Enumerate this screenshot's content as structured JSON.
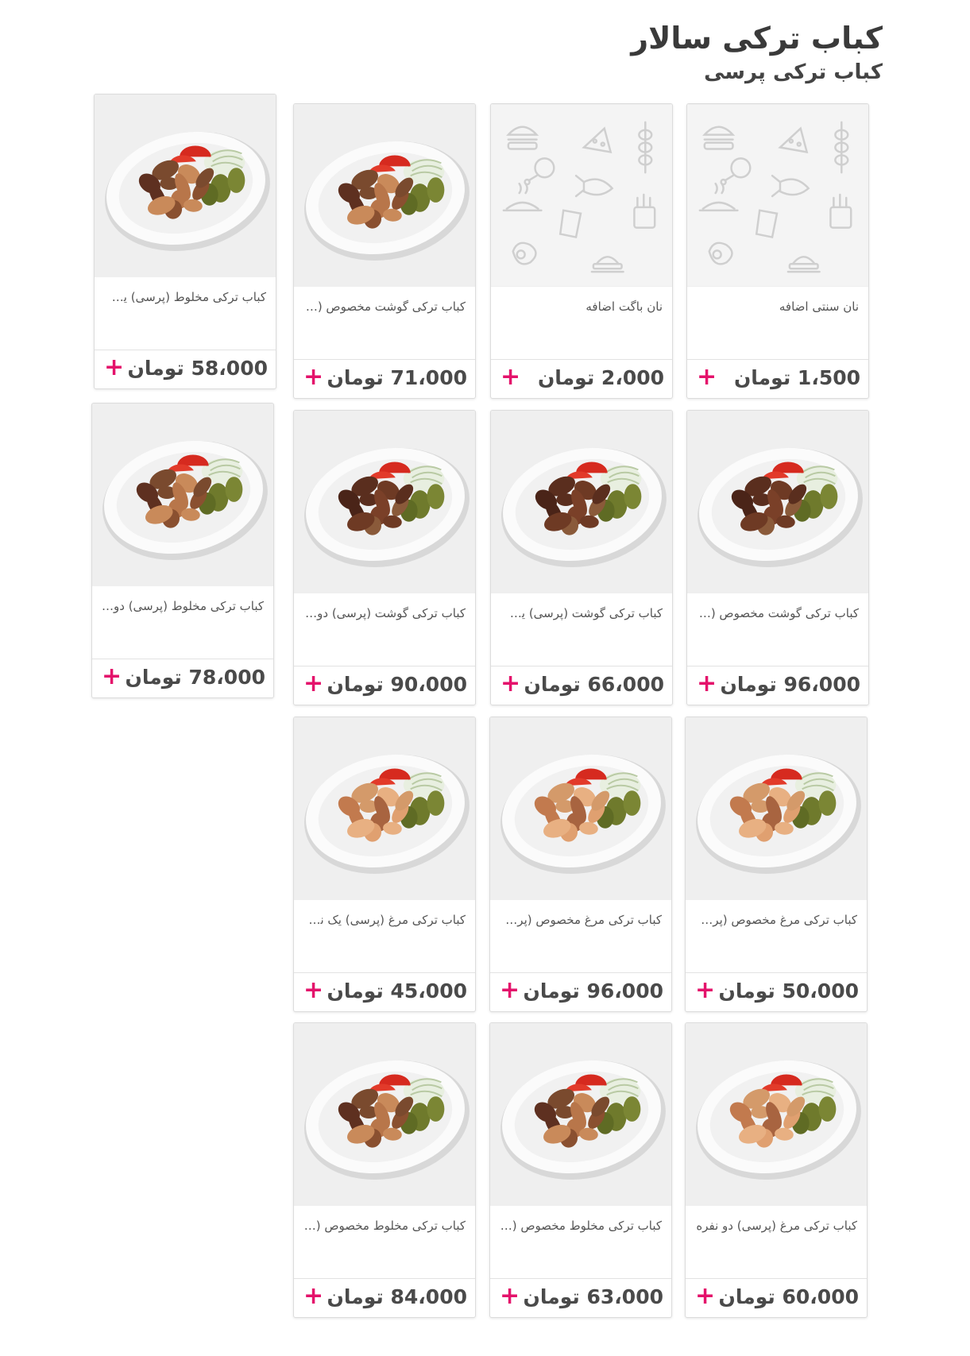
{
  "header": {
    "title": "کباب ترکی سالار",
    "subtitle": "کباب ترکی پرسی"
  },
  "colors": {
    "accent": "#e4126b",
    "card_image_bg": "#efefef"
  },
  "add_icon": "plus-icon",
  "placeholder_icons": [
    "burger-icon",
    "pizza-icon",
    "skewer-icon",
    "chicken-leg-icon",
    "fish-icon",
    "dish-icon",
    "drink-cup-icon",
    "fries-icon",
    "fried-egg-icon",
    "sandwich-icon"
  ],
  "products": [
    {
      "name": "نان سنتی اضافه",
      "price": "1،500 تومان",
      "image": "placeholder"
    },
    {
      "name": "نان باگت اضافه",
      "price": "2،000 تومان",
      "image": "placeholder"
    },
    {
      "name": "کباب ترکی گوشت مخصوص (پر…",
      "price": "71،000 تومان",
      "image": "plate-mixed"
    },
    {
      "name": "کباب ترکی مخلوط (پرسی) یک نف…",
      "price": "58،000 تومان",
      "image": "plate-mixed"
    },
    {
      "name": "کباب ترکی گوشت مخصوص (پر…",
      "price": "96،000 تومان",
      "image": "plate-beef"
    },
    {
      "name": "کباب ترکی گوشت (پرسی) یک نفره",
      "price": "66،000 تومان",
      "image": "plate-beef"
    },
    {
      "name": "کباب ترکی گوشت (پرسی) دو نفره",
      "price": "90،000 تومان",
      "image": "plate-beef"
    },
    {
      "name": "کباب ترکی مخلوط (پرسی) دو نفره",
      "price": "78،000 تومان",
      "image": "plate-mixed"
    },
    {
      "name": "کباب ترکی مرغ مخصوص (پرسی…",
      "price": "50،000 تومان",
      "image": "plate-chicken"
    },
    {
      "name": "کباب ترکی مرغ مخصوص (پرسی…",
      "price": "96،000 تومان",
      "image": "plate-chicken"
    },
    {
      "name": "کباب ترکی مرغ (پرسی) یک نفره",
      "price": "45،000 تومان",
      "image": "plate-chicken"
    },
    {
      "name": "کباب ترکی مرغ (پرسی) دو نفره",
      "price": "60،000 تومان",
      "image": "plate-chicken"
    },
    {
      "name": "کباب ترکی مخلوط مخصوص (پر…",
      "price": "63،000 تومان",
      "image": "plate-mixed"
    },
    {
      "name": "کباب ترکی مخلوط مخصوص (پر…",
      "price": "84،000 تومان",
      "image": "plate-mixed"
    }
  ]
}
